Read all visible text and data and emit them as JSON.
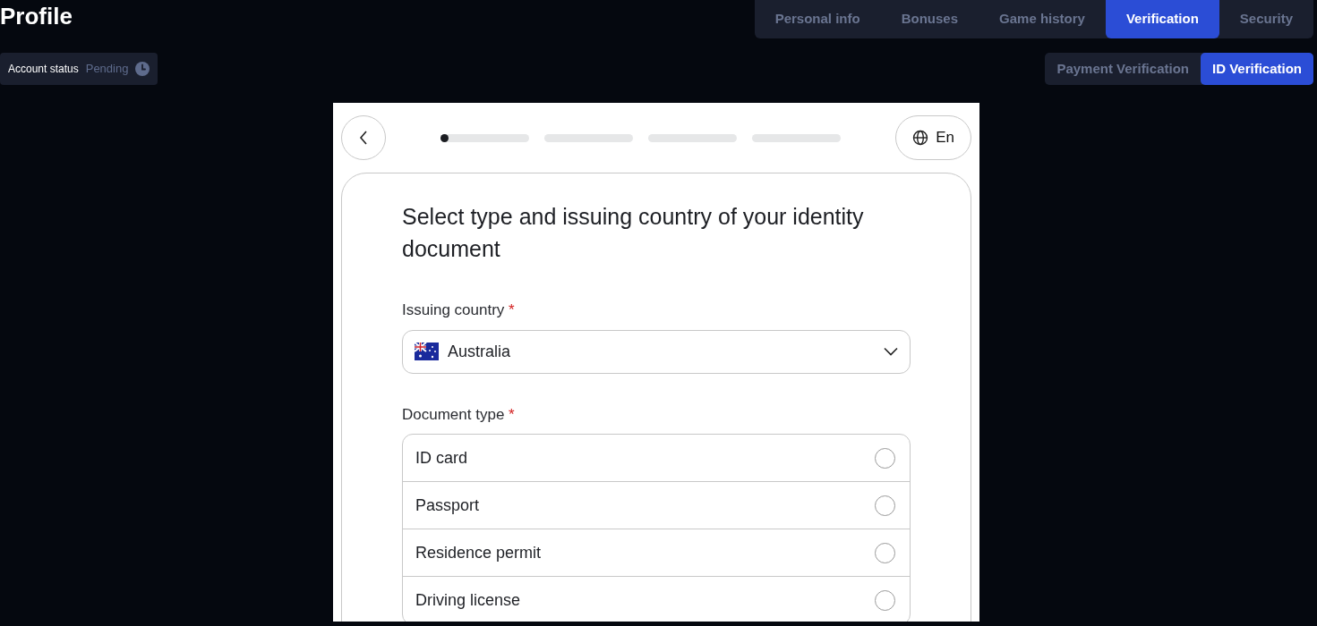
{
  "page": {
    "title": "Profile"
  },
  "tabs": [
    {
      "label": "Personal info",
      "selected": false
    },
    {
      "label": "Bonuses",
      "selected": false
    },
    {
      "label": "Game history",
      "selected": false
    },
    {
      "label": "Verification",
      "selected": true
    },
    {
      "label": "Security",
      "selected": false
    }
  ],
  "account_status": {
    "label": "Account status",
    "value": "Pending"
  },
  "subtabs": [
    {
      "label": "Payment Verification",
      "selected": false
    },
    {
      "label": "ID Verification",
      "selected": true
    }
  ],
  "widget": {
    "progress": {
      "level": 0.02
    },
    "language": "En",
    "heading": "Select type and issuing country of your identity document",
    "country_field": {
      "label": "Issuing country",
      "required_mark": "*",
      "value": "Australia"
    },
    "document_field": {
      "label": "Document type",
      "required_mark": "*"
    },
    "document_types": [
      {
        "label": "ID card",
        "selected": false
      },
      {
        "label": "Passport",
        "selected": false
      },
      {
        "label": "Residence permit",
        "selected": false
      },
      {
        "label": "Driving license",
        "selected": false
      }
    ]
  }
}
